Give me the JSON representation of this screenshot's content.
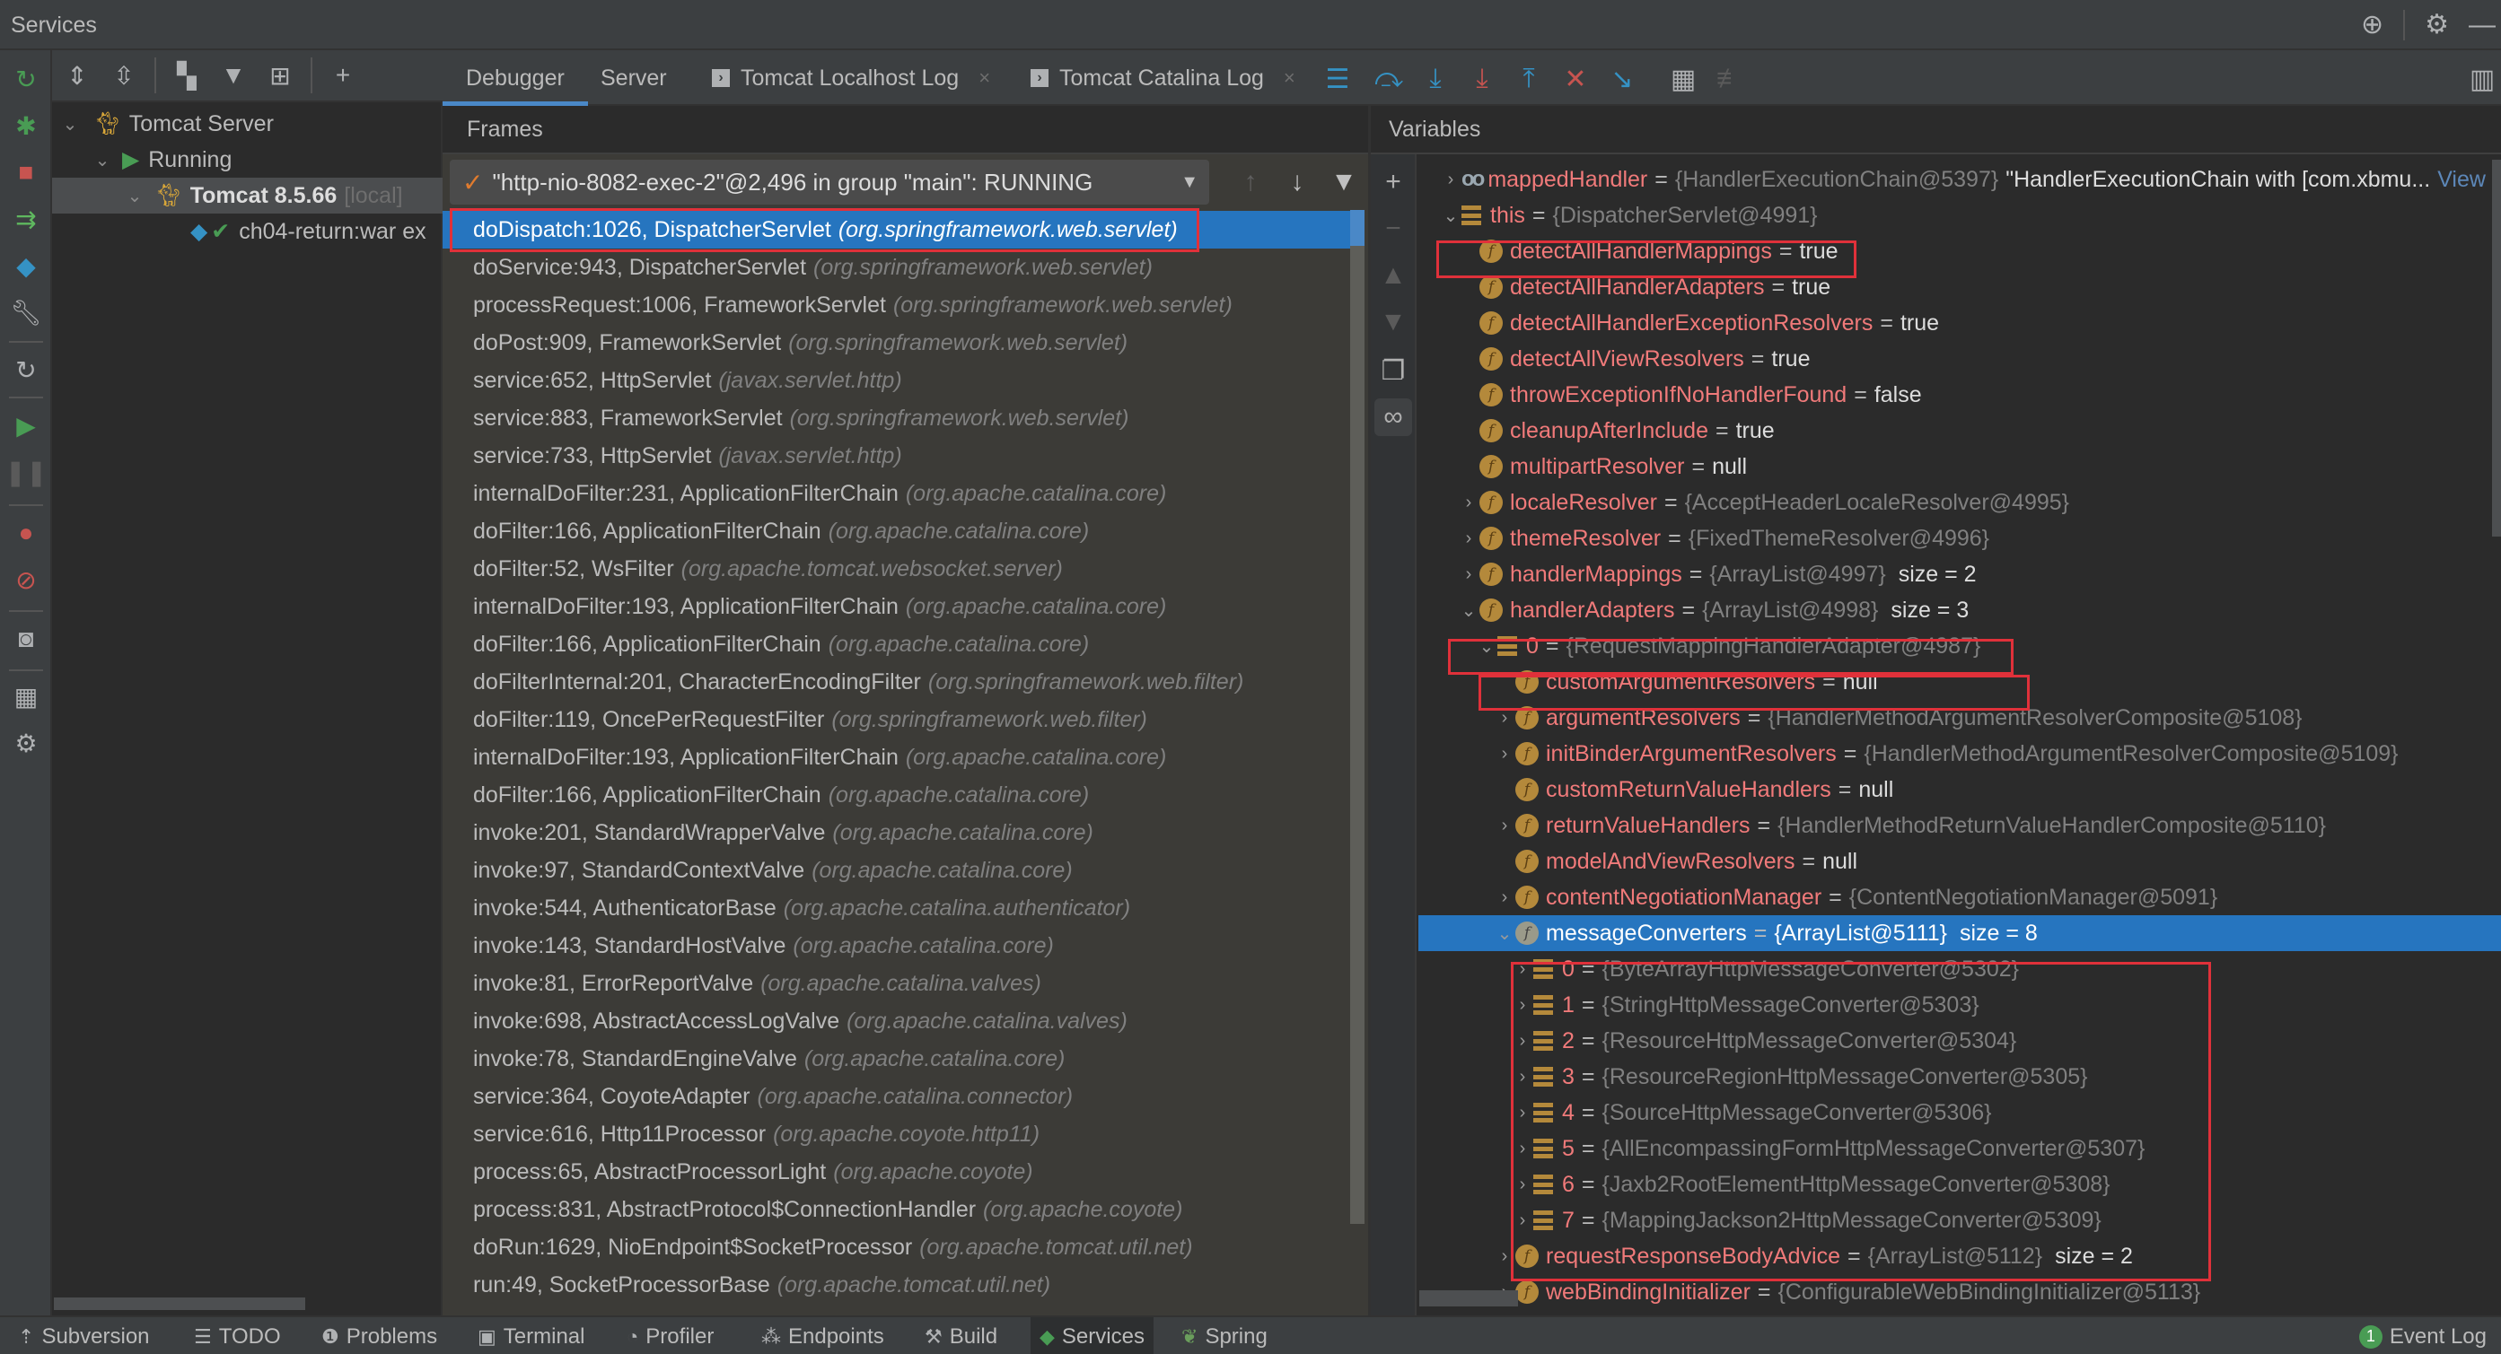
{
  "window": {
    "title": "Services",
    "title_icons": [
      "crosshair-icon",
      "gear-icon",
      "minimize-icon"
    ]
  },
  "left_strip": {
    "icons": [
      "rerun-icon",
      "debug-icon",
      "stop-icon",
      "deploy-icon",
      "services-icon",
      "wrench-icon",
      "refresh-icon",
      "resume-icon",
      "pause-icon",
      "breakpoints-icon",
      "mute-breakpoints-icon",
      "camera-icon",
      "layout-icon",
      "settings-icon"
    ]
  },
  "tree_toolbar": {
    "icons": [
      "expand-all-icon",
      "collapse-all-icon",
      "group-by-icon",
      "filter-icon",
      "new-tab-icon",
      "add-service-icon"
    ]
  },
  "service_tree": [
    {
      "label": "Tomcat Server",
      "icon": "tomcat-icon",
      "expanded": true
    },
    {
      "label": "Running",
      "icon": "running-icon",
      "expanded": true
    },
    {
      "label": "Tomcat 8.5.66",
      "suffix": "[local]",
      "icon": "tomcat-running-icon",
      "expanded": true,
      "selected": true
    },
    {
      "label": "ch04-return:war ex",
      "icon": "artifact-icon",
      "status": "deployed"
    }
  ],
  "debugger_tabs": [
    {
      "label": "Debugger",
      "active": true
    },
    {
      "label": "Server"
    },
    {
      "label": "Tomcat Localhost Log",
      "closable": true
    },
    {
      "label": "Tomcat Catalina Log",
      "closable": true
    }
  ],
  "debug_toolbar": {
    "icons": [
      "show-execution-point-icon",
      "step-over-icon",
      "step-into-icon",
      "force-step-into-icon",
      "step-out-icon",
      "drop-frame-icon",
      "run-to-cursor-icon",
      "evaluate-expression-icon",
      "trace-icon",
      "layout-settings-icon"
    ]
  },
  "frames": {
    "header": "Frames",
    "thread": "\"http-nio-8082-exec-2\"@2,496 in group \"main\": RUNNING",
    "list": [
      {
        "method": "doDispatch:1026, DispatcherServlet",
        "pkg": "(org.springframework.web.servlet)",
        "selected": true
      },
      {
        "method": "doService:943, DispatcherServlet",
        "pkg": "(org.springframework.web.servlet)"
      },
      {
        "method": "processRequest:1006, FrameworkServlet",
        "pkg": "(org.springframework.web.servlet)"
      },
      {
        "method": "doPost:909, FrameworkServlet",
        "pkg": "(org.springframework.web.servlet)"
      },
      {
        "method": "service:652, HttpServlet",
        "pkg": "(javax.servlet.http)"
      },
      {
        "method": "service:883, FrameworkServlet",
        "pkg": "(org.springframework.web.servlet)"
      },
      {
        "method": "service:733, HttpServlet",
        "pkg": "(javax.servlet.http)"
      },
      {
        "method": "internalDoFilter:231, ApplicationFilterChain",
        "pkg": "(org.apache.catalina.core)"
      },
      {
        "method": "doFilter:166, ApplicationFilterChain",
        "pkg": "(org.apache.catalina.core)"
      },
      {
        "method": "doFilter:52, WsFilter",
        "pkg": "(org.apache.tomcat.websocket.server)"
      },
      {
        "method": "internalDoFilter:193, ApplicationFilterChain",
        "pkg": "(org.apache.catalina.core)"
      },
      {
        "method": "doFilter:166, ApplicationFilterChain",
        "pkg": "(org.apache.catalina.core)"
      },
      {
        "method": "doFilterInternal:201, CharacterEncodingFilter",
        "pkg": "(org.springframework.web.filter)"
      },
      {
        "method": "doFilter:119, OncePerRequestFilter",
        "pkg": "(org.springframework.web.filter)"
      },
      {
        "method": "internalDoFilter:193, ApplicationFilterChain",
        "pkg": "(org.apache.catalina.core)"
      },
      {
        "method": "doFilter:166, ApplicationFilterChain",
        "pkg": "(org.apache.catalina.core)"
      },
      {
        "method": "invoke:201, StandardWrapperValve",
        "pkg": "(org.apache.catalina.core)"
      },
      {
        "method": "invoke:97, StandardContextValve",
        "pkg": "(org.apache.catalina.core)"
      },
      {
        "method": "invoke:544, AuthenticatorBase",
        "pkg": "(org.apache.catalina.authenticator)"
      },
      {
        "method": "invoke:143, StandardHostValve",
        "pkg": "(org.apache.catalina.core)"
      },
      {
        "method": "invoke:81, ErrorReportValve",
        "pkg": "(org.apache.catalina.valves)"
      },
      {
        "method": "invoke:698, AbstractAccessLogValve",
        "pkg": "(org.apache.catalina.valves)"
      },
      {
        "method": "invoke:78, StandardEngineValve",
        "pkg": "(org.apache.catalina.core)"
      },
      {
        "method": "service:364, CoyoteAdapter",
        "pkg": "(org.apache.catalina.connector)"
      },
      {
        "method": "service:616, Http11Processor",
        "pkg": "(org.apache.coyote.http11)"
      },
      {
        "method": "process:65, AbstractProcessorLight",
        "pkg": "(org.apache.coyote)"
      },
      {
        "method": "process:831, AbstractProtocol$ConnectionHandler",
        "pkg": "(org.apache.coyote)"
      },
      {
        "method": "doRun:1629, NioEndpoint$SocketProcessor",
        "pkg": "(org.apache.tomcat.util.net)"
      },
      {
        "method": "run:49, SocketProcessorBase",
        "pkg": "(org.apache.tomcat.util.net)"
      }
    ]
  },
  "variables": {
    "header": "Variables",
    "strip_icons": [
      "add-watch-icon",
      "remove-watch-icon",
      "move-up-icon",
      "move-down-icon",
      "copy-icon",
      "show-watches-icon"
    ],
    "rows": [
      {
        "depth": 0,
        "chev": ">",
        "icon": "oo",
        "name": "mappedHandler",
        "type": "{HandlerExecutionChain@5397}",
        "value": "\"HandlerExecutionChain with [com.xbmu...",
        "link": "View"
      },
      {
        "depth": 0,
        "chev": "v",
        "icon": "arr",
        "name": "this",
        "type": "{DispatcherServlet@4991}"
      },
      {
        "depth": 1,
        "chev": "",
        "icon": "f",
        "name": "detectAllHandlerMappings",
        "value": "true"
      },
      {
        "depth": 1,
        "chev": "",
        "icon": "f",
        "name": "detectAllHandlerAdapters",
        "value": "true"
      },
      {
        "depth": 1,
        "chev": "",
        "icon": "f",
        "name": "detectAllHandlerExceptionResolvers",
        "value": "true"
      },
      {
        "depth": 1,
        "chev": "",
        "icon": "f",
        "name": "detectAllViewResolvers",
        "value": "true"
      },
      {
        "depth": 1,
        "chev": "",
        "icon": "f",
        "name": "throwExceptionIfNoHandlerFound",
        "value": "false"
      },
      {
        "depth": 1,
        "chev": "",
        "icon": "f",
        "name": "cleanupAfterInclude",
        "value": "true"
      },
      {
        "depth": 1,
        "chev": "",
        "icon": "f",
        "name": "multipartResolver",
        "value": "null"
      },
      {
        "depth": 1,
        "chev": ">",
        "icon": "f",
        "name": "localeResolver",
        "type": "{AcceptHeaderLocaleResolver@4995}"
      },
      {
        "depth": 1,
        "chev": ">",
        "icon": "f",
        "name": "themeResolver",
        "type": "{FixedThemeResolver@4996}"
      },
      {
        "depth": 1,
        "chev": ">",
        "icon": "f",
        "name": "handlerMappings",
        "type": "{ArrayList@4997}",
        "size": "size = 2"
      },
      {
        "depth": 1,
        "chev": "v",
        "icon": "f",
        "name": "handlerAdapters",
        "type": "{ArrayList@4998}",
        "size": "size = 3"
      },
      {
        "depth": 2,
        "chev": "v",
        "icon": "arr",
        "name": "0",
        "type": "{RequestMappingHandlerAdapter@4987}"
      },
      {
        "depth": 3,
        "chev": "",
        "icon": "f",
        "name": "customArgumentResolvers",
        "value": "null"
      },
      {
        "depth": 3,
        "chev": ">",
        "icon": "f",
        "name": "argumentResolvers",
        "type": "{HandlerMethodArgumentResolverComposite@5108}"
      },
      {
        "depth": 3,
        "chev": ">",
        "icon": "f",
        "name": "initBinderArgumentResolvers",
        "type": "{HandlerMethodArgumentResolverComposite@5109}"
      },
      {
        "depth": 3,
        "chev": "",
        "icon": "f",
        "name": "customReturnValueHandlers",
        "value": "null"
      },
      {
        "depth": 3,
        "chev": ">",
        "icon": "f",
        "name": "returnValueHandlers",
        "type": "{HandlerMethodReturnValueHandlerComposite@5110}"
      },
      {
        "depth": 3,
        "chev": "",
        "icon": "f",
        "name": "modelAndViewResolvers",
        "value": "null"
      },
      {
        "depth": 3,
        "chev": ">",
        "icon": "f",
        "name": "contentNegotiationManager",
        "type": "{ContentNegotiationManager@5091}"
      },
      {
        "depth": 3,
        "chev": "v",
        "icon": "f",
        "name": "messageConverters",
        "type": "{ArrayList@5111}",
        "size": "size = 8",
        "selected": true
      },
      {
        "depth": 4,
        "chev": ">",
        "icon": "arr",
        "name": "0",
        "type": "{ByteArrayHttpMessageConverter@5302}"
      },
      {
        "depth": 4,
        "chev": ">",
        "icon": "arr",
        "name": "1",
        "type": "{StringHttpMessageConverter@5303}"
      },
      {
        "depth": 4,
        "chev": ">",
        "icon": "arr",
        "name": "2",
        "type": "{ResourceHttpMessageConverter@5304}"
      },
      {
        "depth": 4,
        "chev": ">",
        "icon": "arr",
        "name": "3",
        "type": "{ResourceRegionHttpMessageConverter@5305}"
      },
      {
        "depth": 4,
        "chev": ">",
        "icon": "arr",
        "name": "4",
        "type": "{SourceHttpMessageConverter@5306}"
      },
      {
        "depth": 4,
        "chev": ">",
        "icon": "arr",
        "name": "5",
        "type": "{AllEncompassingFormHttpMessageConverter@5307}"
      },
      {
        "depth": 4,
        "chev": ">",
        "icon": "arr",
        "name": "6",
        "type": "{Jaxb2RootElementHttpMessageConverter@5308}"
      },
      {
        "depth": 4,
        "chev": ">",
        "icon": "arr",
        "name": "7",
        "type": "{MappingJackson2HttpMessageConverter@5309}"
      },
      {
        "depth": 3,
        "chev": ">",
        "icon": "f",
        "name": "requestResponseBodyAdvice",
        "type": "{ArrayList@5112}",
        "size": "size = 2"
      },
      {
        "depth": 3,
        "chev": ">",
        "icon": "f",
        "name": "webBindingInitializer",
        "type": "{ConfigurableWebBindingInitializer@5113}"
      }
    ]
  },
  "status_bar": {
    "items": [
      {
        "label": "Subversion",
        "icon": "subversion-icon"
      },
      {
        "label": "TODO",
        "icon": "todo-icon"
      },
      {
        "label": "Problems",
        "icon": "problems-icon"
      },
      {
        "label": "Terminal",
        "icon": "terminal-icon"
      },
      {
        "label": "Profiler",
        "icon": "profiler-icon"
      },
      {
        "label": "Endpoints",
        "icon": "endpoints-icon"
      },
      {
        "label": "Build",
        "icon": "build-icon"
      },
      {
        "label": "Services",
        "icon": "services-icon",
        "active": true
      },
      {
        "label": "Spring",
        "icon": "spring-icon"
      }
    ],
    "event_log": {
      "label": "Event Log",
      "count": "1"
    }
  },
  "colors": {
    "selection": "#2675bf",
    "highlight_box": "#e0313a",
    "field_name": "#f07a7a",
    "field_icon": "#b4893b"
  }
}
